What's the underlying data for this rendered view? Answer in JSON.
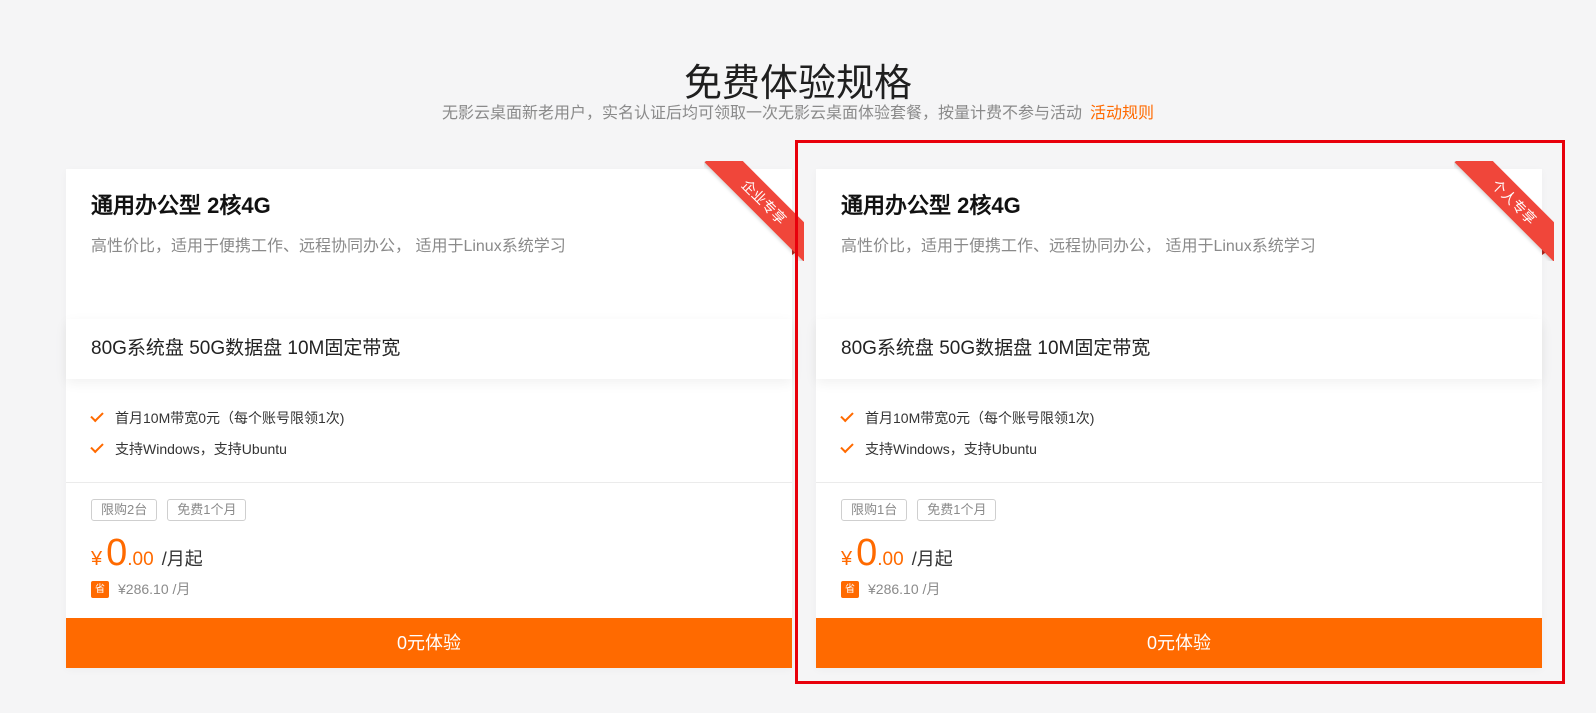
{
  "header": {
    "title": "免费体验规格",
    "subtitle": "无影云桌面新老用户，实名认证后均可领取一次无影云桌面体验套餐，按量计费不参与活动",
    "rules_link": "活动规则"
  },
  "colors": {
    "accent": "#ff6a00",
    "ribbon": "#f0463a",
    "highlight_border": "#e8000b"
  },
  "cards": [
    {
      "ribbon": "企业专享",
      "title": "通用办公型 2核4G",
      "desc": "高性价比，适用于便携工作、远程协同办公， 适用于Linux系统学习",
      "spec": "80G系统盘 50G数据盘 10M固定带宽",
      "features": [
        "首月10M带宽0元（每个账号限领1次)",
        "支持Windows，支持Ubuntu"
      ],
      "tags": [
        "限购2台",
        "免费1个月"
      ],
      "price": {
        "currency": "¥",
        "int": "0",
        "dec": ".00",
        "unit": "/月起"
      },
      "save_badge": "省",
      "original_price": "¥286.10 /月",
      "cta": "0元体验"
    },
    {
      "ribbon": "个人专享",
      "title": "通用办公型 2核4G",
      "desc": "高性价比，适用于便携工作、远程协同办公， 适用于Linux系统学习",
      "spec": "80G系统盘 50G数据盘 10M固定带宽",
      "features": [
        "首月10M带宽0元（每个账号限领1次)",
        "支持Windows，支持Ubuntu"
      ],
      "tags": [
        "限购1台",
        "免费1个月"
      ],
      "price": {
        "currency": "¥",
        "int": "0",
        "dec": ".00",
        "unit": "/月起"
      },
      "save_badge": "省",
      "original_price": "¥286.10 /月",
      "cta": "0元体验"
    }
  ]
}
